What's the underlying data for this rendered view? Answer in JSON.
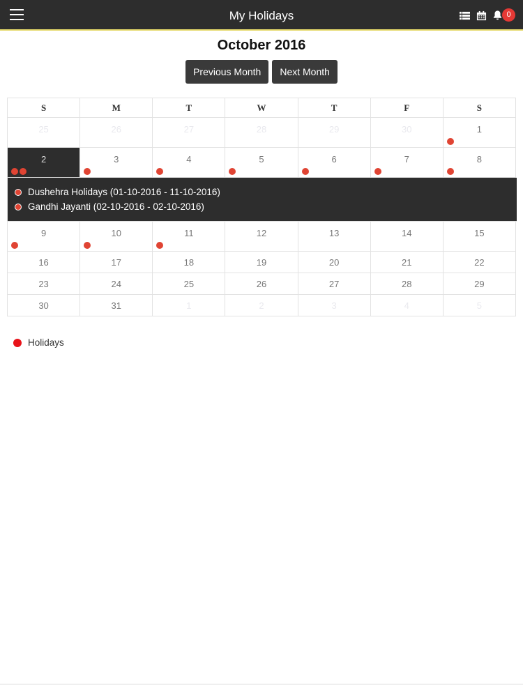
{
  "header": {
    "title": "My Holidays",
    "menu_icon": "hamburger-menu-icon",
    "list_icon": "list-view-icon",
    "calendar_icon": "calendar-icon",
    "bell_icon": "bell-icon",
    "notification_count": "0",
    "bar_color": "#2d2d2d",
    "badge_color": "#e53935"
  },
  "month_title": "October 2016",
  "buttons": {
    "previous": "Previous Month",
    "next": "Next Month"
  },
  "weekdays": [
    "S",
    "M",
    "T",
    "W",
    "T",
    "F",
    "S"
  ],
  "weeks": [
    [
      "25",
      "26",
      "27",
      "28",
      "29",
      "30",
      "1"
    ],
    [
      "2",
      "3",
      "4",
      "5",
      "6",
      "7",
      "8"
    ],
    [
      "9",
      "10",
      "11",
      "12",
      "13",
      "14",
      "15"
    ],
    [
      "16",
      "17",
      "18",
      "19",
      "20",
      "21",
      "22"
    ],
    [
      "23",
      "24",
      "25",
      "26",
      "27",
      "28",
      "29"
    ],
    [
      "30",
      "31",
      "1",
      "2",
      "3",
      "4",
      "5"
    ]
  ],
  "selected_day": "2",
  "events": [
    "Dushehra Holidays (01-10-2016 - 11-10-2016)",
    "Gandhi Jayanti (02-10-2016 - 02-10-2016)"
  ],
  "holiday_dot_color": "#e04433",
  "legend": {
    "label": "Holidays",
    "color": "#e8131a"
  }
}
